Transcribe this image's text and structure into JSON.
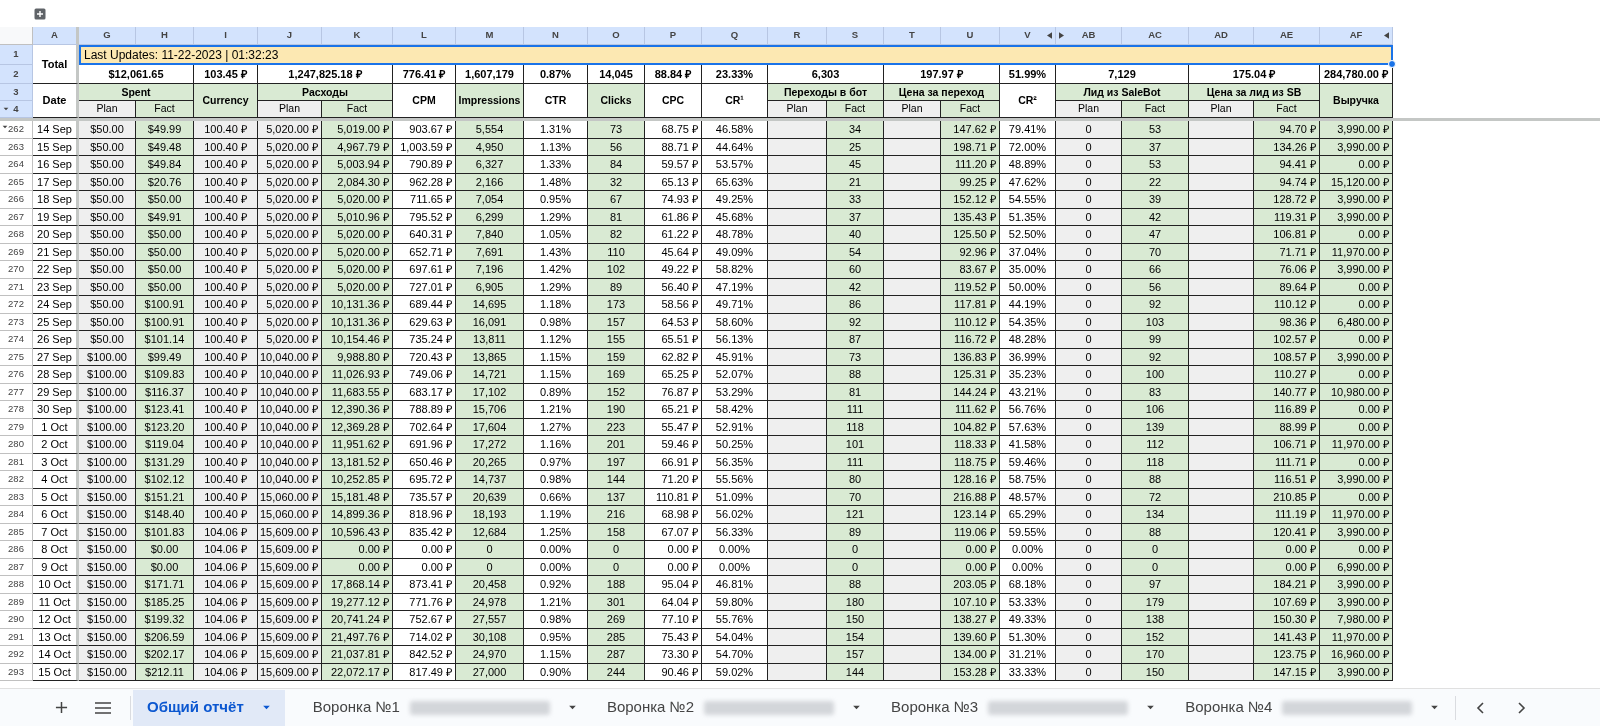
{
  "column_headers": [
    "A",
    "G",
    "H",
    "I",
    "J",
    "K",
    "L",
    "M",
    "N",
    "O",
    "P",
    "Q",
    "R",
    "S",
    "T",
    "U",
    "V",
    "AB",
    "AC",
    "AD",
    "AE",
    "AF"
  ],
  "header_row_numbers": [
    "1",
    "2",
    "3",
    "4"
  ],
  "total_label": "Total",
  "last_updated": "Last Updates: 11-22-2023 | 01:32:23",
  "date_label": "Date",
  "groups": [
    {
      "label": "Spent",
      "total": "$12,061.65",
      "sub": [
        "Plan",
        "Fact"
      ]
    },
    {
      "label": "Currency",
      "total": "103.45 ₽"
    },
    {
      "label": "Расходы",
      "total": "1,247,825.18 ₽",
      "sub": [
        "Plan",
        "Fact"
      ]
    },
    {
      "label": "CPM",
      "total": "776.41 ₽"
    },
    {
      "label": "Impressions",
      "total": "1,607,179"
    },
    {
      "label": "CTR",
      "total": "0.87%"
    },
    {
      "label": "Clicks",
      "total": "14,045"
    },
    {
      "label": "CPC",
      "total": "88.84 ₽"
    },
    {
      "label": "CR¹",
      "total": "23.33%"
    },
    {
      "label": "Переходы в бот",
      "total": "6,303",
      "sub": [
        "Plan",
        "Fact"
      ]
    },
    {
      "label": "Цена за переход",
      "total": "197.97 ₽",
      "sub": [
        "Plan",
        "Fact"
      ]
    },
    {
      "label": "CR²",
      "total": "51.99%"
    },
    {
      "label": "Лид из SaleBot",
      "total": "7,129",
      "sub": [
        "Plan",
        "Fact"
      ]
    },
    {
      "label": "Цена за лид из SB",
      "total": "175.04 ₽",
      "sub": [
        "Plan",
        "Fact"
      ]
    },
    {
      "label": "Выручка",
      "total": "284,780.00 ₽"
    }
  ],
  "rows": [
    {
      "row": "262",
      "cells": [
        "14 Sep",
        "$50.00",
        "$49.99",
        "100.40 ₽",
        "5,020.00 ₽",
        "5,019.00 ₽",
        "903.67 ₽",
        "5,554",
        "1.31%",
        "73",
        "68.75 ₽",
        "46.58%",
        "34",
        "147.62 ₽",
        "79.41%",
        "0",
        "53",
        "94.70 ₽",
        "3,990.00 ₽"
      ]
    },
    {
      "row": "263",
      "cells": [
        "15 Sep",
        "$50.00",
        "$49.48",
        "100.40 ₽",
        "5,020.00 ₽",
        "4,967.79 ₽",
        "1,003.59 ₽",
        "4,950",
        "1.13%",
        "56",
        "88.71 ₽",
        "44.64%",
        "25",
        "198.71 ₽",
        "72.00%",
        "0",
        "37",
        "134.26 ₽",
        "3,990.00 ₽"
      ]
    },
    {
      "row": "264",
      "cells": [
        "16 Sep",
        "$50.00",
        "$49.84",
        "100.40 ₽",
        "5,020.00 ₽",
        "5,003.94 ₽",
        "790.89 ₽",
        "6,327",
        "1.33%",
        "84",
        "59.57 ₽",
        "53.57%",
        "45",
        "111.20 ₽",
        "48.89%",
        "0",
        "53",
        "94.41 ₽",
        "0.00 ₽"
      ]
    },
    {
      "row": "265",
      "cells": [
        "17 Sep",
        "$50.00",
        "$20.76",
        "100.40 ₽",
        "5,020.00 ₽",
        "2,084.30 ₽",
        "962.28 ₽",
        "2,166",
        "1.48%",
        "32",
        "65.13 ₽",
        "65.63%",
        "21",
        "99.25 ₽",
        "47.62%",
        "0",
        "22",
        "94.74 ₽",
        "15,120.00 ₽"
      ]
    },
    {
      "row": "266",
      "cells": [
        "18 Sep",
        "$50.00",
        "$50.00",
        "100.40 ₽",
        "5,020.00 ₽",
        "5,020.00 ₽",
        "711.65 ₽",
        "7,054",
        "0.95%",
        "67",
        "74.93 ₽",
        "49.25%",
        "33",
        "152.12 ₽",
        "54.55%",
        "0",
        "39",
        "128.72 ₽",
        "3,990.00 ₽"
      ]
    },
    {
      "row": "267",
      "cells": [
        "19 Sep",
        "$50.00",
        "$49.91",
        "100.40 ₽",
        "5,020.00 ₽",
        "5,010.96 ₽",
        "795.52 ₽",
        "6,299",
        "1.29%",
        "81",
        "61.86 ₽",
        "45.68%",
        "37",
        "135.43 ₽",
        "51.35%",
        "0",
        "42",
        "119.31 ₽",
        "3,990.00 ₽"
      ]
    },
    {
      "row": "268",
      "cells": [
        "20 Sep",
        "$50.00",
        "$50.00",
        "100.40 ₽",
        "5,020.00 ₽",
        "5,020.00 ₽",
        "640.31 ₽",
        "7,840",
        "1.05%",
        "82",
        "61.22 ₽",
        "48.78%",
        "40",
        "125.50 ₽",
        "52.50%",
        "0",
        "47",
        "106.81 ₽",
        "0.00 ₽"
      ]
    },
    {
      "row": "269",
      "cells": [
        "21 Sep",
        "$50.00",
        "$50.00",
        "100.40 ₽",
        "5,020.00 ₽",
        "5,020.00 ₽",
        "652.71 ₽",
        "7,691",
        "1.43%",
        "110",
        "45.64 ₽",
        "49.09%",
        "54",
        "92.96 ₽",
        "37.04%",
        "0",
        "70",
        "71.71 ₽",
        "11,970.00 ₽"
      ]
    },
    {
      "row": "270",
      "cells": [
        "22 Sep",
        "$50.00",
        "$50.00",
        "100.40 ₽",
        "5,020.00 ₽",
        "5,020.00 ₽",
        "697.61 ₽",
        "7,196",
        "1.42%",
        "102",
        "49.22 ₽",
        "58.82%",
        "60",
        "83.67 ₽",
        "35.00%",
        "0",
        "66",
        "76.06 ₽",
        "3,990.00 ₽"
      ]
    },
    {
      "row": "271",
      "cells": [
        "23 Sep",
        "$50.00",
        "$50.00",
        "100.40 ₽",
        "5,020.00 ₽",
        "5,020.00 ₽",
        "727.01 ₽",
        "6,905",
        "1.29%",
        "89",
        "56.40 ₽",
        "47.19%",
        "42",
        "119.52 ₽",
        "50.00%",
        "0",
        "56",
        "89.64 ₽",
        "0.00 ₽"
      ]
    },
    {
      "row": "272",
      "cells": [
        "24 Sep",
        "$50.00",
        "$100.91",
        "100.40 ₽",
        "5,020.00 ₽",
        "10,131.36 ₽",
        "689.44 ₽",
        "14,695",
        "1.18%",
        "173",
        "58.56 ₽",
        "49.71%",
        "86",
        "117.81 ₽",
        "44.19%",
        "0",
        "92",
        "110.12 ₽",
        "0.00 ₽"
      ]
    },
    {
      "row": "273",
      "cells": [
        "25 Sep",
        "$50.00",
        "$100.91",
        "100.40 ₽",
        "5,020.00 ₽",
        "10,131.36 ₽",
        "629.63 ₽",
        "16,091",
        "0.98%",
        "157",
        "64.53 ₽",
        "58.60%",
        "92",
        "110.12 ₽",
        "54.35%",
        "0",
        "103",
        "98.36 ₽",
        "6,480.00 ₽"
      ]
    },
    {
      "row": "274",
      "cells": [
        "26 Sep",
        "$50.00",
        "$101.14",
        "100.40 ₽",
        "5,020.00 ₽",
        "10,154.46 ₽",
        "735.24 ₽",
        "13,811",
        "1.12%",
        "155",
        "65.51 ₽",
        "56.13%",
        "87",
        "116.72 ₽",
        "48.28%",
        "0",
        "99",
        "102.57 ₽",
        "0.00 ₽"
      ]
    },
    {
      "row": "275",
      "cells": [
        "27 Sep",
        "$100.00",
        "$99.49",
        "100.40 ₽",
        "10,040.00 ₽",
        "9,988.80 ₽",
        "720.43 ₽",
        "13,865",
        "1.15%",
        "159",
        "62.82 ₽",
        "45.91%",
        "73",
        "136.83 ₽",
        "36.99%",
        "0",
        "92",
        "108.57 ₽",
        "3,990.00 ₽"
      ]
    },
    {
      "row": "276",
      "cells": [
        "28 Sep",
        "$100.00",
        "$109.83",
        "100.40 ₽",
        "10,040.00 ₽",
        "11,026.93 ₽",
        "749.06 ₽",
        "14,721",
        "1.15%",
        "169",
        "65.25 ₽",
        "52.07%",
        "88",
        "125.31 ₽",
        "35.23%",
        "0",
        "100",
        "110.27 ₽",
        "0.00 ₽"
      ]
    },
    {
      "row": "277",
      "cells": [
        "29 Sep",
        "$100.00",
        "$116.37",
        "100.40 ₽",
        "10,040.00 ₽",
        "11,683.55 ₽",
        "683.17 ₽",
        "17,102",
        "0.89%",
        "152",
        "76.87 ₽",
        "53.29%",
        "81",
        "144.24 ₽",
        "43.21%",
        "0",
        "83",
        "140.77 ₽",
        "10,980.00 ₽"
      ]
    },
    {
      "row": "278",
      "cells": [
        "30 Sep",
        "$100.00",
        "$123.41",
        "100.40 ₽",
        "10,040.00 ₽",
        "12,390.36 ₽",
        "788.89 ₽",
        "15,706",
        "1.21%",
        "190",
        "65.21 ₽",
        "58.42%",
        "111",
        "111.62 ₽",
        "56.76%",
        "0",
        "106",
        "116.89 ₽",
        "0.00 ₽"
      ]
    },
    {
      "row": "279",
      "cells": [
        "1 Oct",
        "$100.00",
        "$123.20",
        "100.40 ₽",
        "10,040.00 ₽",
        "12,369.28 ₽",
        "702.64 ₽",
        "17,604",
        "1.27%",
        "223",
        "55.47 ₽",
        "52.91%",
        "118",
        "104.82 ₽",
        "57.63%",
        "0",
        "139",
        "88.99 ₽",
        "0.00 ₽"
      ]
    },
    {
      "row": "280",
      "cells": [
        "2 Oct",
        "$100.00",
        "$119.04",
        "100.40 ₽",
        "10,040.00 ₽",
        "11,951.62 ₽",
        "691.96 ₽",
        "17,272",
        "1.16%",
        "201",
        "59.46 ₽",
        "50.25%",
        "101",
        "118.33 ₽",
        "41.58%",
        "0",
        "112",
        "106.71 ₽",
        "11,970.00 ₽"
      ]
    },
    {
      "row": "281",
      "cells": [
        "3 Oct",
        "$100.00",
        "$131.29",
        "100.40 ₽",
        "10,040.00 ₽",
        "13,181.52 ₽",
        "650.46 ₽",
        "20,265",
        "0.97%",
        "197",
        "66.91 ₽",
        "56.35%",
        "111",
        "118.75 ₽",
        "59.46%",
        "0",
        "118",
        "111.71 ₽",
        "0.00 ₽"
      ]
    },
    {
      "row": "282",
      "cells": [
        "4 Oct",
        "$100.00",
        "$102.12",
        "100.40 ₽",
        "10,040.00 ₽",
        "10,252.85 ₽",
        "695.72 ₽",
        "14,737",
        "0.98%",
        "144",
        "71.20 ₽",
        "55.56%",
        "80",
        "128.16 ₽",
        "58.75%",
        "0",
        "88",
        "116.51 ₽",
        "3,990.00 ₽"
      ]
    },
    {
      "row": "283",
      "cells": [
        "5 Oct",
        "$150.00",
        "$151.21",
        "100.40 ₽",
        "15,060.00 ₽",
        "15,181.48 ₽",
        "735.57 ₽",
        "20,639",
        "0.66%",
        "137",
        "110.81 ₽",
        "51.09%",
        "70",
        "216.88 ₽",
        "48.57%",
        "0",
        "72",
        "210.85 ₽",
        "0.00 ₽"
      ]
    },
    {
      "row": "284",
      "cells": [
        "6 Oct",
        "$150.00",
        "$148.40",
        "100.40 ₽",
        "15,060.00 ₽",
        "14,899.36 ₽",
        "818.96 ₽",
        "18,193",
        "1.19%",
        "216",
        "68.98 ₽",
        "56.02%",
        "121",
        "123.14 ₽",
        "65.29%",
        "0",
        "134",
        "111.19 ₽",
        "11,970.00 ₽"
      ]
    },
    {
      "row": "285",
      "cells": [
        "7 Oct",
        "$150.00",
        "$101.83",
        "104.06 ₽",
        "15,609.00 ₽",
        "10,596.43 ₽",
        "835.42 ₽",
        "12,684",
        "1.25%",
        "158",
        "67.07 ₽",
        "56.33%",
        "89",
        "119.06 ₽",
        "59.55%",
        "0",
        "88",
        "120.41 ₽",
        "3,990.00 ₽"
      ]
    },
    {
      "row": "286",
      "cells": [
        "8 Oct",
        "$150.00",
        "$0.00",
        "104.06 ₽",
        "15,609.00 ₽",
        "0.00 ₽",
        "0.00 ₽",
        "0",
        "0.00%",
        "0",
        "0.00 ₽",
        "0.00%",
        "0",
        "0.00 ₽",
        "0.00%",
        "0",
        "0",
        "0.00 ₽",
        "0.00 ₽"
      ]
    },
    {
      "row": "287",
      "cells": [
        "9 Oct",
        "$150.00",
        "$0.00",
        "104.06 ₽",
        "15,609.00 ₽",
        "0.00 ₽",
        "0.00 ₽",
        "0",
        "0.00%",
        "0",
        "0.00 ₽",
        "0.00%",
        "0",
        "0.00 ₽",
        "0.00%",
        "0",
        "0",
        "0.00 ₽",
        "6,990.00 ₽"
      ]
    },
    {
      "row": "288",
      "cells": [
        "10 Oct",
        "$150.00",
        "$171.71",
        "104.06 ₽",
        "15,609.00 ₽",
        "17,868.14 ₽",
        "873.41 ₽",
        "20,458",
        "0.92%",
        "188",
        "95.04 ₽",
        "46.81%",
        "88",
        "203.05 ₽",
        "68.18%",
        "0",
        "97",
        "184.21 ₽",
        "3,990.00 ₽"
      ]
    },
    {
      "row": "289",
      "cells": [
        "11 Oct",
        "$150.00",
        "$185.25",
        "104.06 ₽",
        "15,609.00 ₽",
        "19,277.12 ₽",
        "771.76 ₽",
        "24,978",
        "1.21%",
        "301",
        "64.04 ₽",
        "59.80%",
        "180",
        "107.10 ₽",
        "53.33%",
        "0",
        "179",
        "107.69 ₽",
        "3,990.00 ₽"
      ]
    },
    {
      "row": "290",
      "cells": [
        "12 Oct",
        "$150.00",
        "$199.32",
        "104.06 ₽",
        "15,609.00 ₽",
        "20,741.24 ₽",
        "752.67 ₽",
        "27,557",
        "0.98%",
        "269",
        "77.10 ₽",
        "55.76%",
        "150",
        "138.27 ₽",
        "49.33%",
        "0",
        "138",
        "150.30 ₽",
        "7,980.00 ₽"
      ]
    },
    {
      "row": "291",
      "cells": [
        "13 Oct",
        "$150.00",
        "$206.59",
        "104.06 ₽",
        "15,609.00 ₽",
        "21,497.76 ₽",
        "714.02 ₽",
        "30,108",
        "0.95%",
        "285",
        "75.43 ₽",
        "54.04%",
        "154",
        "139.60 ₽",
        "51.30%",
        "0",
        "152",
        "141.43 ₽",
        "11,970.00 ₽"
      ]
    },
    {
      "row": "292",
      "cells": [
        "14 Oct",
        "$150.00",
        "$202.17",
        "104.06 ₽",
        "15,609.00 ₽",
        "21,037.81 ₽",
        "842.52 ₽",
        "24,970",
        "1.15%",
        "287",
        "73.30 ₽",
        "54.70%",
        "157",
        "134.00 ₽",
        "31.21%",
        "0",
        "170",
        "123.75 ₽",
        "16,960.00 ₽"
      ]
    },
    {
      "row": "293",
      "cells": [
        "15 Oct",
        "$150.00",
        "$212.11",
        "104.06 ₽",
        "15,609.00 ₽",
        "22,072.17 ₽",
        "817.49 ₽",
        "27,000",
        "0.90%",
        "244",
        "90.46 ₽",
        "59.02%",
        "144",
        "153.28 ₽",
        "33.33%",
        "0",
        "150",
        "147.15 ₽",
        "3,990.00 ₽"
      ]
    }
  ],
  "tabs": [
    {
      "label": "Общий отчёт",
      "selected": true,
      "redacted": false
    },
    {
      "label": "Воронка №1",
      "selected": false,
      "redacted": true
    },
    {
      "label": "Воронка №2",
      "selected": false,
      "redacted": true
    },
    {
      "label": "Воронка №3",
      "selected": false,
      "redacted": true
    },
    {
      "label": "Воронка №4",
      "selected": false,
      "redacted": true
    }
  ]
}
